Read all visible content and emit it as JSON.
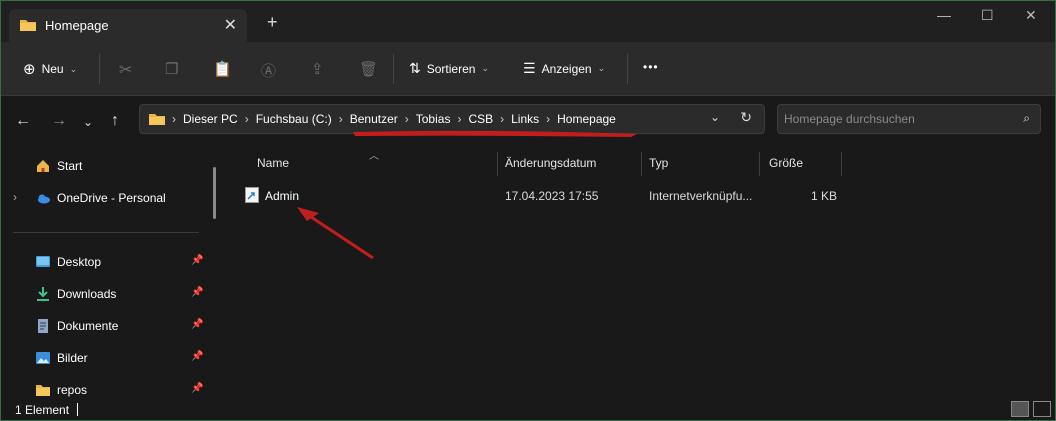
{
  "window": {
    "tab_title": "Homepage",
    "new_tab": "+",
    "colors": {
      "accent": "#c21e1e",
      "folder": "#e8b54a"
    }
  },
  "toolbar": {
    "new_label": "Neu",
    "sort_label": "Sortieren",
    "view_label": "Anzeigen",
    "more_label": "•••"
  },
  "address": {
    "crumbs": [
      "Dieser PC",
      "Fuchsbau (C:)",
      "Benutzer",
      "Tobias",
      "CSB",
      "Links",
      "Homepage"
    ],
    "search_placeholder": "Homepage durchsuchen"
  },
  "sidebar": {
    "items": [
      {
        "label": "Start",
        "icon": "home-icon"
      },
      {
        "label": "OneDrive - Personal",
        "icon": "onedrive-icon"
      },
      {
        "label": "Desktop",
        "icon": "desktop-icon"
      },
      {
        "label": "Downloads",
        "icon": "download-icon"
      },
      {
        "label": "Dokumente",
        "icon": "document-icon"
      },
      {
        "label": "Bilder",
        "icon": "pictures-icon"
      },
      {
        "label": "repos",
        "icon": "folder-icon"
      }
    ]
  },
  "list": {
    "columns": [
      "Name",
      "Änderungsdatum",
      "Typ",
      "Größe"
    ],
    "rows": [
      {
        "name": "Admin",
        "date": "17.04.2023 17:55",
        "type": "Internetverknüpfu...",
        "size": "1 KB"
      }
    ]
  },
  "status": {
    "count": "1 Element"
  }
}
